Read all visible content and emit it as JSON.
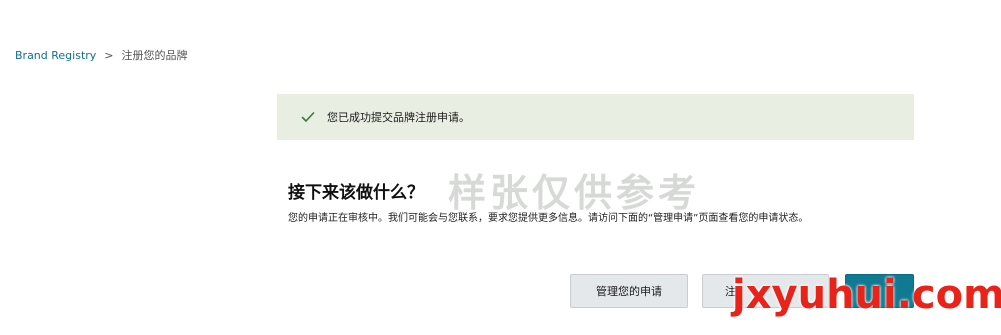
{
  "breadcrumb": {
    "root": "Brand Registry",
    "separator": ">",
    "current": "注册您的品牌"
  },
  "banner": {
    "message": "您已成功提交品牌注册申请。",
    "icon": "check-icon",
    "background": "#e9eee2",
    "icon_color": "#3b7a3b"
  },
  "main": {
    "title": "接下来该做什么？",
    "description": "您的申请正在审核中。我们可能会与您联系，要求您提供更多信息。请访问下面的“管理申请”页面查看您的申请状态。"
  },
  "buttons": {
    "manage": "管理您的申请",
    "register": "注",
    "primary": ""
  },
  "overlays": {
    "sample_watermark": "样张仅供参考",
    "site_watermark": "jxyuhui.com"
  },
  "colors": {
    "link": "#0f6f8f",
    "primary_button": "#0f7a92",
    "site_watermark": "#e8231a"
  }
}
